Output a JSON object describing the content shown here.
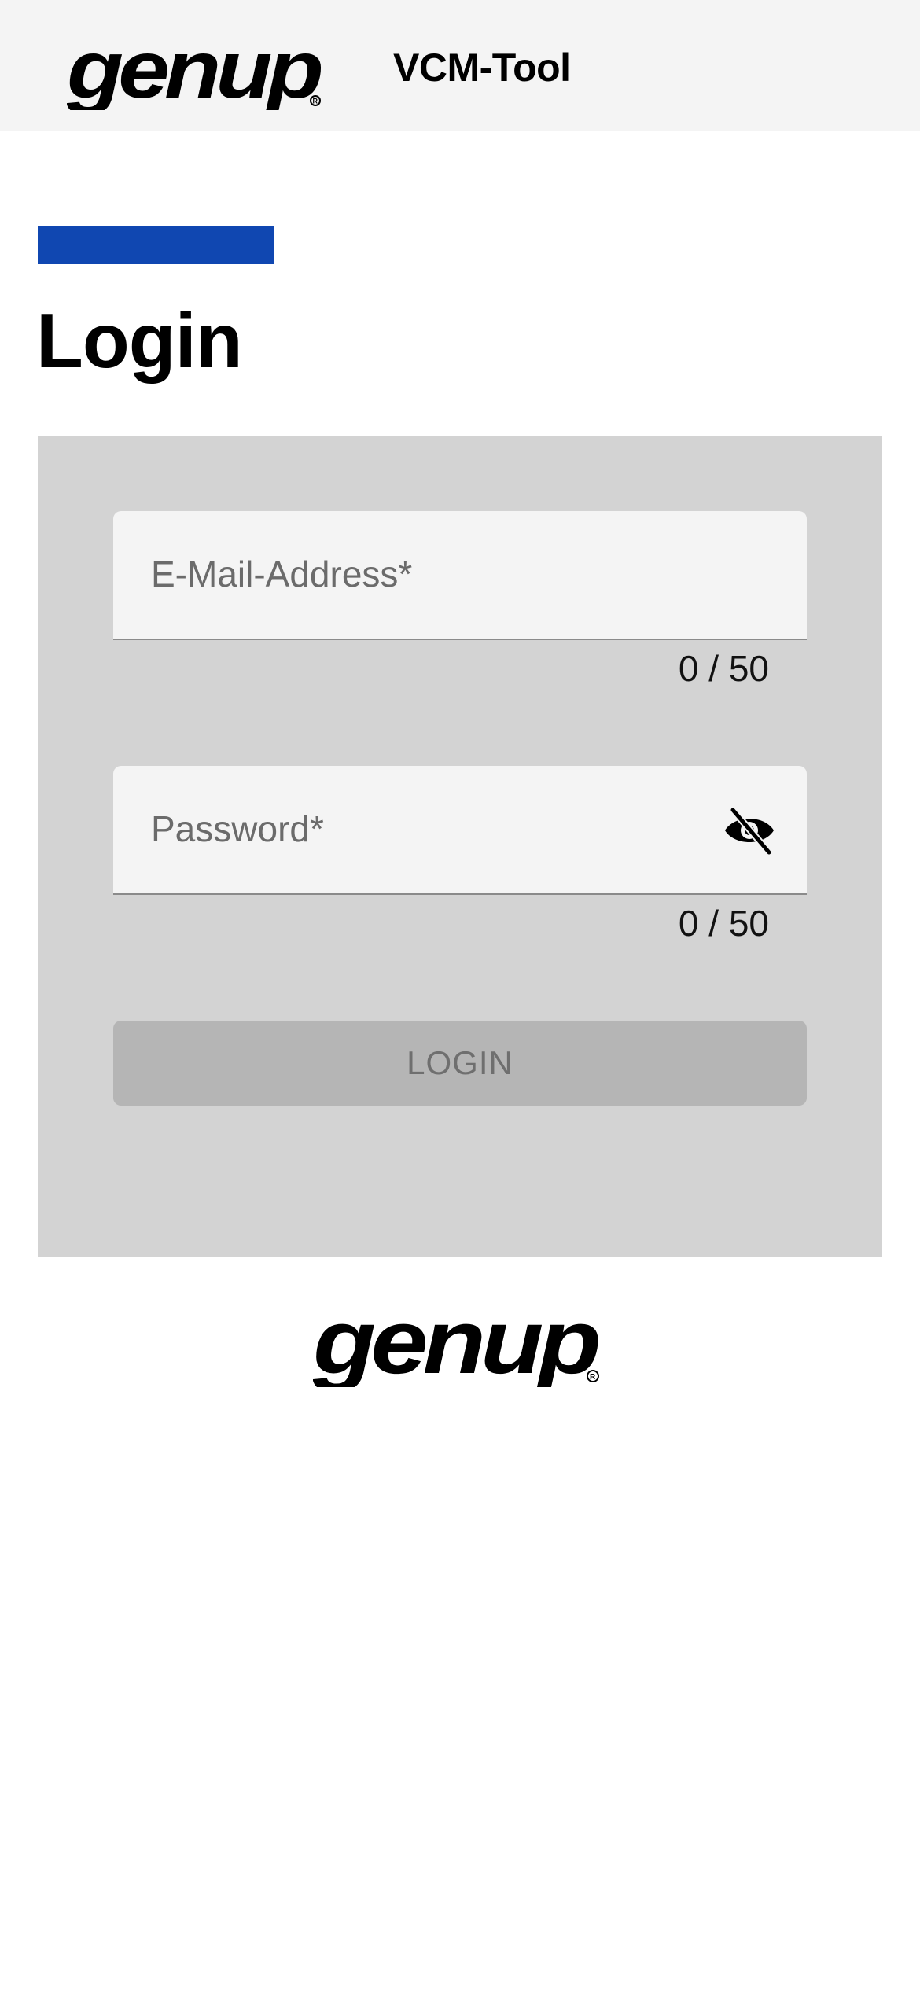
{
  "header": {
    "logo_text": "genup",
    "title": "VCM-Tool"
  },
  "page": {
    "title": "Login",
    "accent_color": "#1047b1"
  },
  "form": {
    "email": {
      "placeholder": "E-Mail-Address*",
      "value": "",
      "counter": "0 / 50"
    },
    "password": {
      "placeholder": "Password*",
      "value": "",
      "counter": "0 / 50",
      "toggle_icon": "eye-off-icon"
    },
    "login_button": {
      "label": "LOGIN",
      "disabled": true
    }
  },
  "footer": {
    "logo_text": "genup"
  }
}
